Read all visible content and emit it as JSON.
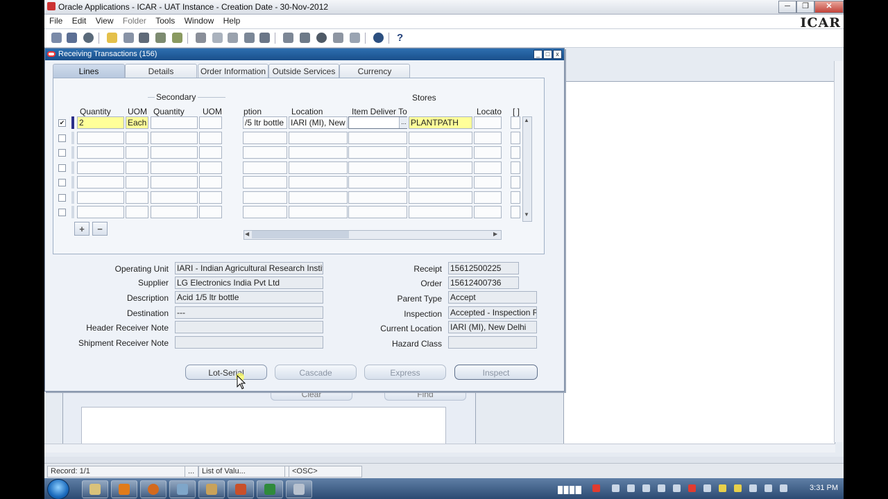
{
  "window": {
    "title": "Oracle Applications - ICAR - UAT Instance - Creation Date - 30-Nov-2012",
    "minimize": "─",
    "maximize": "❐",
    "close": "✕"
  },
  "menu": [
    "File",
    "Edit",
    "View",
    "Folder",
    "Tools",
    "Window",
    "Help"
  ],
  "logo": "ICAR",
  "dialog": {
    "title": "Receiving Transactions (156)",
    "tabs": [
      "Lines",
      "Details",
      "Order Information",
      "Outside Services",
      "Currency"
    ],
    "active_tab": "Lines",
    "group_labels": {
      "secondary": "Secondary",
      "stores": "Stores"
    },
    "columns": {
      "quantity": "Quantity",
      "uom": "UOM",
      "sec_quantity": "Quantity",
      "sec_uom": "UOM",
      "description": "ption",
      "location": "Location",
      "item_deliver_to": "Item Deliver To",
      "stores": "",
      "locator": "Locato",
      "flex": "[ ]"
    },
    "rows": [
      {
        "checked": true,
        "quantity": "2",
        "uom": "Each",
        "sec_quantity": "",
        "sec_uom": "",
        "description": "/5 ltr bottle",
        "location": "IARI (MI), New D",
        "item_deliver_to": "",
        "stores": "PLANTPATH",
        "locator": ""
      },
      {
        "checked": false,
        "quantity": "",
        "uom": "",
        "sec_quantity": "",
        "sec_uom": "",
        "description": "",
        "location": "",
        "item_deliver_to": "",
        "stores": "",
        "locator": ""
      },
      {
        "checked": false,
        "quantity": "",
        "uom": "",
        "sec_quantity": "",
        "sec_uom": "",
        "description": "",
        "location": "",
        "item_deliver_to": "",
        "stores": "",
        "locator": ""
      },
      {
        "checked": false,
        "quantity": "",
        "uom": "",
        "sec_quantity": "",
        "sec_uom": "",
        "description": "",
        "location": "",
        "item_deliver_to": "",
        "stores": "",
        "locator": ""
      },
      {
        "checked": false,
        "quantity": "",
        "uom": "",
        "sec_quantity": "",
        "sec_uom": "",
        "description": "",
        "location": "",
        "item_deliver_to": "",
        "stores": "",
        "locator": ""
      },
      {
        "checked": false,
        "quantity": "",
        "uom": "",
        "sec_quantity": "",
        "sec_uom": "",
        "description": "",
        "location": "",
        "item_deliver_to": "",
        "stores": "",
        "locator": ""
      },
      {
        "checked": false,
        "quantity": "",
        "uom": "",
        "sec_quantity": "",
        "sec_uom": "",
        "description": "",
        "location": "",
        "item_deliver_to": "",
        "stores": "",
        "locator": ""
      }
    ],
    "add_row": "+",
    "remove_row": "−",
    "lov_button": "...",
    "details": {
      "operating_unit": {
        "label": "Operating Unit",
        "value": "IARI - Indian Agricultural Research Institu"
      },
      "supplier": {
        "label": "Supplier",
        "value": "LG Electronics India Pvt Ltd"
      },
      "description": {
        "label": "Description",
        "value": "Acid 1/5 ltr bottle"
      },
      "destination": {
        "label": "Destination",
        "value": "---"
      },
      "header_receiver_note": {
        "label": "Header Receiver Note",
        "value": ""
      },
      "shipment_receiver_note": {
        "label": "Shipment Receiver Note",
        "value": ""
      },
      "receipt": {
        "label": "Receipt",
        "value": "15612500225"
      },
      "order": {
        "label": "Order",
        "value": "15612400736"
      },
      "parent_type": {
        "label": "Parent Type",
        "value": "Accept"
      },
      "inspection": {
        "label": "Inspection",
        "value": "Accepted - Inspection R"
      },
      "current_location": {
        "label": "Current Location",
        "value": "IARI (MI), New Delhi"
      },
      "hazard_class": {
        "label": "Hazard Class",
        "value": ""
      }
    },
    "buttons": {
      "lot_serial": "Lot-Serial",
      "cascade": "Cascade",
      "express": "Express",
      "inspect": "Inspect"
    }
  },
  "background_form": {
    "clear": "Clear",
    "find": "Find"
  },
  "status_bar": {
    "record": "Record: 1/1",
    "ellipsis": "...",
    "list_of_values": "List of Valu...",
    "osc": "<OSC>"
  },
  "taskbar": {
    "time": "3:31 PM"
  }
}
